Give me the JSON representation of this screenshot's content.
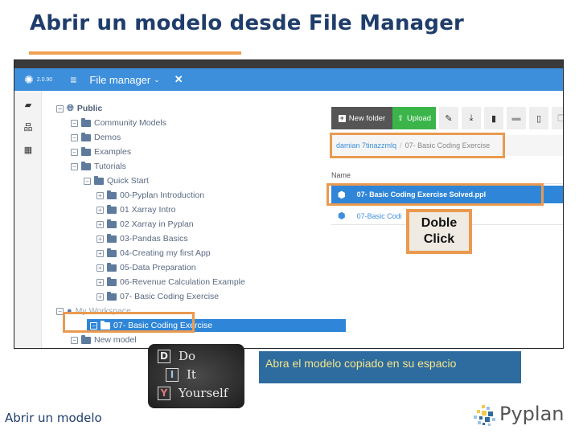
{
  "slide": {
    "title": "Abrir un modelo desde File Manager",
    "footer_label": "Abrir un modelo",
    "accent_color": "#f0a050",
    "title_color": "#1f3d6b"
  },
  "app": {
    "logo_icon": "pyplan-gear-icon",
    "version": "2.0.90",
    "menu_icon": "hamburger-icon",
    "title": "File manager",
    "title_caret": "⌄",
    "close_icon": "✕",
    "accent_color": "#3d8fdc"
  },
  "sidebar": {
    "items": [
      {
        "icon": "folder-open-icon",
        "glyph": "▰"
      },
      {
        "icon": "sitemap-icon",
        "glyph": "品"
      },
      {
        "icon": "grid-icon",
        "glyph": "▦"
      }
    ]
  },
  "tree": {
    "items": [
      {
        "label": "Public",
        "toggle": "−",
        "type": "globe",
        "bold": true
      },
      {
        "label": "Community Models",
        "toggle": "−",
        "type": "folder"
      },
      {
        "label": "Demos",
        "toggle": "−",
        "type": "folder"
      },
      {
        "label": "Examples",
        "toggle": "−",
        "type": "folder"
      },
      {
        "label": "Tutorials",
        "toggle": "−",
        "type": "folder"
      },
      {
        "label": "Quick Start",
        "toggle": "−",
        "type": "folder"
      },
      {
        "label": "00-Pyplan Introduction",
        "toggle": "+",
        "type": "folder"
      },
      {
        "label": "01 Xarray Intro",
        "toggle": "+",
        "type": "folder"
      },
      {
        "label": "02 Xarray in Pyplan",
        "toggle": "+",
        "type": "folder"
      },
      {
        "label": "03-Pandas Basics",
        "toggle": "+",
        "type": "folder"
      },
      {
        "label": "04-Creating my first App",
        "toggle": "+",
        "type": "folder"
      },
      {
        "label": "05-Data Preparation",
        "toggle": "+",
        "type": "folder"
      },
      {
        "label": "06-Revenue Calculation Example",
        "toggle": "+",
        "type": "folder"
      },
      {
        "label": "07- Basic Coding Exercise",
        "toggle": "+",
        "type": "folder"
      },
      {
        "label": "My Workspace",
        "toggle": "−",
        "type": "user"
      },
      {
        "label": "07- Basic Coding Exercise",
        "toggle": "−",
        "type": "folder",
        "selected": true
      },
      {
        "label": "New model",
        "toggle": "−",
        "type": "folder"
      }
    ]
  },
  "toolbar": {
    "new_folder_label": "New folder",
    "new_folder_icon": "+",
    "upload_label": "Upload",
    "upload_icon": "⇪",
    "icons": [
      {
        "name": "edit-icon",
        "glyph": "✎"
      },
      {
        "name": "download-icon",
        "glyph": "⤓"
      },
      {
        "name": "trash-icon",
        "glyph": "▮"
      },
      {
        "name": "archive-icon",
        "glyph": "▬"
      },
      {
        "name": "file-icon",
        "glyph": "▯"
      },
      {
        "name": "copy-icon",
        "glyph": "❐"
      }
    ]
  },
  "breadcrumb": {
    "root": "damian 7tinazzmlq",
    "separator": "/",
    "current": "07- Basic Coding Exercise"
  },
  "files": {
    "column_name": "Name",
    "rows": [
      {
        "name": "07- Basic Coding Exercise Solved.ppl",
        "icon": "cube-icon",
        "selected": true
      },
      {
        "name": "07-Basic Coding Exercise.ppl",
        "visible_name": "07-Basic Codi",
        "icon": "cube-icon",
        "selected": false
      }
    ]
  },
  "callout": {
    "line1": "Doble",
    "line2": "Click"
  },
  "diy": {
    "letters": [
      "D",
      "I",
      "Y"
    ],
    "words": [
      "Do",
      "It",
      "Yourself"
    ]
  },
  "caption": {
    "text": "Abra el modelo copiado en su espacio"
  },
  "brand": {
    "name": "Pyplan"
  }
}
